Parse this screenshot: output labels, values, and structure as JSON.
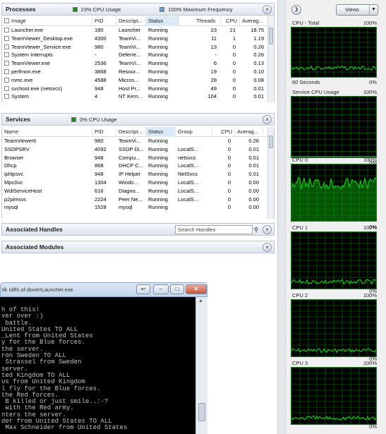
{
  "processes": {
    "title": "Processes",
    "cpu_usage": "23% CPU Usage",
    "max_frequency": "100% Maximum Frequency",
    "columns": [
      "Image",
      "PID",
      "Descript...",
      "Status",
      "Threads",
      "CPU",
      "Averag..."
    ],
    "rows": [
      {
        "image": "Launcher.exe",
        "pid": "180",
        "desc": "Launcher",
        "status": "Running",
        "threads": "23",
        "cpu": "21",
        "avg": "18.75"
      },
      {
        "image": "TeamViewer_Desktop.exe",
        "pid": "4300",
        "desc": "TeamVi...",
        "status": "Running",
        "threads": "11",
        "cpu": "1",
        "avg": "1.19"
      },
      {
        "image": "TeamViewer_Service.exe",
        "pid": "980",
        "desc": "TeamVi...",
        "status": "Running",
        "threads": "13",
        "cpu": "0",
        "avg": "0.26"
      },
      {
        "image": "System Interrupts",
        "pid": "-",
        "desc": "Deferre...",
        "status": "Running",
        "threads": "-",
        "cpu": "0",
        "avg": "0.26"
      },
      {
        "image": "TeamViewer.exe",
        "pid": "2536",
        "desc": "TeamVi...",
        "status": "Running",
        "threads": "6",
        "cpu": "0",
        "avg": "0.13"
      },
      {
        "image": "perfmon.exe",
        "pid": "3868",
        "desc": "Resour...",
        "status": "Running",
        "threads": "19",
        "cpu": "0",
        "avg": "0.10"
      },
      {
        "image": "mmc.exe",
        "pid": "4588",
        "desc": "Micros...",
        "status": "Running",
        "threads": "28",
        "cpu": "0",
        "avg": "0.08"
      },
      {
        "image": "svchost.exe (netsvcs)",
        "pid": "948",
        "desc": "Host Pr...",
        "status": "Running",
        "threads": "49",
        "cpu": "0",
        "avg": "0.01"
      },
      {
        "image": "System",
        "pid": "4",
        "desc": "NT Kern...",
        "status": "Running",
        "threads": "104",
        "cpu": "0",
        "avg": "0.01"
      }
    ]
  },
  "services": {
    "title": "Services",
    "cpu_usage": "0% CPU Usage",
    "columns": [
      "Name",
      "PID",
      "Descript...",
      "Status",
      "Group",
      "CPU",
      "Averag..."
    ],
    "rows": [
      {
        "name": "TeamViewer6",
        "pid": "980",
        "desc": "TeamVi...",
        "status": "Running",
        "group": "",
        "cpu": "0",
        "avg": "0.26"
      },
      {
        "name": "SSDPSRV",
        "pid": "4092",
        "desc": "SSDP Di...",
        "status": "Running",
        "group": "LocalS...",
        "cpu": "0",
        "avg": "0.01"
      },
      {
        "name": "Browser",
        "pid": "948",
        "desc": "Compu...",
        "status": "Running",
        "group": "netsvcs",
        "cpu": "0",
        "avg": "0.01"
      },
      {
        "name": "Dhcp",
        "pid": "868",
        "desc": "DHCP C...",
        "status": "Running",
        "group": "LocalS...",
        "cpu": "0",
        "avg": "0.01"
      },
      {
        "name": "iphlpsvc",
        "pid": "948",
        "desc": "IP Helper",
        "status": "Running",
        "group": "NetSvcs",
        "cpu": "0",
        "avg": "0.01"
      },
      {
        "name": "MpsSvc",
        "pid": "1304",
        "desc": "Windo...",
        "status": "Running",
        "group": "LocalS...",
        "cpu": "0",
        "avg": "0.00"
      },
      {
        "name": "WdiServiceHost",
        "pid": "616",
        "desc": "Diagno...",
        "status": "Running",
        "group": "LocalS...",
        "cpu": "0",
        "avg": "0.00"
      },
      {
        "name": "p2pimsvc",
        "pid": "2224",
        "desc": "Peer Ne...",
        "status": "Running",
        "group": "LocalS...",
        "cpu": "0",
        "avg": "0.00"
      },
      {
        "name": "mysql",
        "pid": "1528",
        "desc": "mysql",
        "status": "Running",
        "group": "",
        "cpu": "0",
        "avg": "0.00"
      }
    ]
  },
  "handles": {
    "title": "Associated Handles",
    "search_placeholder": "Search Handles"
  },
  "modules": {
    "title": "Associated Modules"
  },
  "cmd_window": {
    "title": "tik cliffs of dover\\Launcher.exe",
    "lines": [
      "h of this!",
      "ver over :)",
      " battle.",
      "United States TO ALL",
      "_Lent from United States",
      "y for the Blue forces.",
      "",
      "",
      "the server.",
      "ron Sweden TO ALL",
      " Strassel from Sweden",
      "server.",
      "ted Kingdom TO ALL",
      "us from United Kingdom",
      "l fly for the Blue forces.",
      "the Red forces.",
      " B killed or just smile..:-?",
      " with the Red army.",
      "nters the server.",
      "der from United States TO ALL",
      " Max Schneider from United States"
    ]
  },
  "right_pane": {
    "views_label": "Views",
    "graphs": [
      {
        "title": "CPU - Total",
        "max": "100%",
        "bottom_left": "60 Seconds",
        "bottom_right": "0%",
        "type": "total"
      },
      {
        "title": "Service CPU Usage",
        "max": "100%",
        "bottom_left": "",
        "bottom_right": "0%",
        "type": "service"
      },
      {
        "title": "CPU 0",
        "max": "100%",
        "bottom_left": "",
        "bottom_right": "0%",
        "type": "cpu0"
      },
      {
        "title": "CPU 1",
        "max": "100%",
        "bottom_left": "",
        "bottom_right": "0%",
        "type": "cpu1"
      },
      {
        "title": "CPU 2",
        "max": "100%",
        "bottom_left": "",
        "bottom_right": "0%",
        "type": "cpu2"
      },
      {
        "title": "CPU 3",
        "max": "100%",
        "bottom_left": "",
        "bottom_right": "0%",
        "type": "cpu3"
      }
    ]
  },
  "colors": {
    "graph_grid": "#0a7a0a",
    "graph_line": "#19d619",
    "cpu_indicator": "#1a8a1a",
    "freq_indicator": "#5aa0e6"
  }
}
